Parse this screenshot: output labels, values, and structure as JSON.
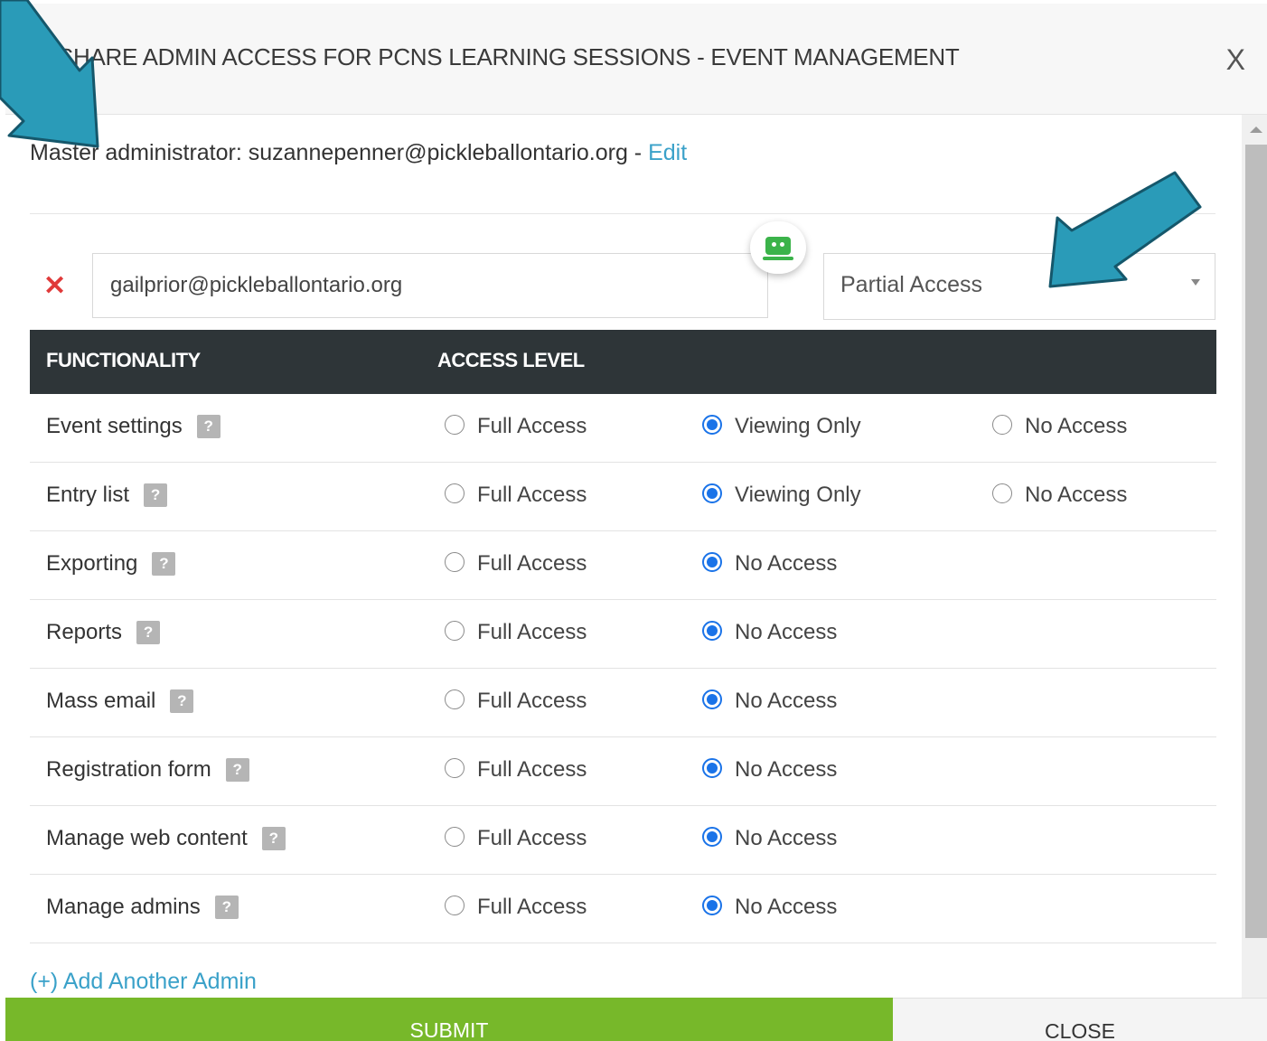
{
  "modal": {
    "title": "SHARE ADMIN ACCESS FOR PCNS LEARNING SESSIONS - EVENT MANAGEMENT",
    "close_symbol": "X"
  },
  "master": {
    "prefix": "Master administrator:",
    "email": "suzannepenner@pickleballontario.org",
    "dash": " - ",
    "edit_label": "Edit"
  },
  "admin": {
    "remove_symbol": "✕",
    "email_value": "gailprior@pickleballontario.org",
    "access_select": "Partial Access"
  },
  "table": {
    "headers": [
      "FUNCTIONALITY",
      "ACCESS LEVEL"
    ],
    "help_symbol": "?",
    "rows": [
      {
        "label": "Event settings",
        "options": [
          "Full Access",
          "Viewing Only",
          "No Access"
        ],
        "selected": 1
      },
      {
        "label": "Entry list",
        "options": [
          "Full Access",
          "Viewing Only",
          "No Access"
        ],
        "selected": 1
      },
      {
        "label": "Exporting",
        "options": [
          "Full Access",
          "No Access"
        ],
        "selected": 1
      },
      {
        "label": "Reports",
        "options": [
          "Full Access",
          "No Access"
        ],
        "selected": 1
      },
      {
        "label": "Mass email",
        "options": [
          "Full Access",
          "No Access"
        ],
        "selected": 1
      },
      {
        "label": "Registration form",
        "options": [
          "Full Access",
          "No Access"
        ],
        "selected": 1
      },
      {
        "label": "Manage web content",
        "options": [
          "Full Access",
          "No Access"
        ],
        "selected": 1
      },
      {
        "label": "Manage admins",
        "options": [
          "Full Access",
          "No Access"
        ],
        "selected": 1
      }
    ]
  },
  "add_admin_label": "(+) Add Another Admin",
  "footer": {
    "submit_label": "SUBMIT",
    "close_label": "CLOSE"
  },
  "colors": {
    "accent_link": "#3aa1c9",
    "submit_green": "#77b82a",
    "header_dark": "#2e3538",
    "radio_blue": "#1a73e8",
    "annotation_arrow": "#2a9bb8",
    "remove_red": "#e03a3a"
  },
  "icons": {
    "close": "close-icon",
    "remove": "remove-icon",
    "help": "help-icon",
    "caret": "chevron-down-icon",
    "bubble": "chat-bot-icon",
    "annotation": "arrow-annotation-icon"
  }
}
